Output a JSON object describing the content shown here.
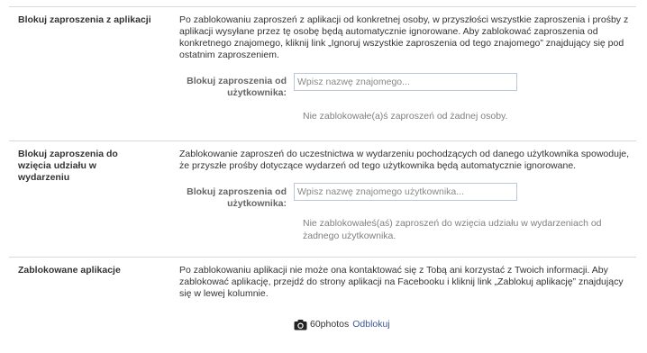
{
  "sections": {
    "apps": {
      "title": "Blokuj zaproszenia z aplikacji",
      "description": "Po zablokowaniu zaproszeń z aplikacji od konkretnej osoby, w przyszłości wszystkie zaproszenia i prośby z aplikacji wysyłane przez tę osobę będą automatycznie ignorowane. Aby zablokować zaproszenia od konkretnego znajomego, kliknij link „Ignoruj wszystkie zaproszenia od tego znajomego” znajdujący się pod ostatnim zaproszeniem.",
      "field_label": "Blokuj zaproszenia od użytkownika:",
      "input_value": "",
      "input_placeholder": "Wpisz nazwę znajomego...",
      "note": "Nie zablokowałe(a)ś zaproszeń od żadnej osoby."
    },
    "events": {
      "title": "Blokuj zaproszenia do wzięcia udziału w wydarzeniu",
      "description": "Zablokowanie zaproszeń do uczestnictwa w wydarzeniu pochodzących od danego użytkownika spowoduje, że przyszłe prośby dotyczące wydarzeń od tego użytkownika będą automatycznie ignorowane.",
      "field_label": "Blokuj zaproszenia od użytkownika:",
      "input_value": "",
      "input_placeholder": "Wpisz nazwę znajomego użytkownika...",
      "note": "Nie zablokowałeś(aś) zaproszeń do wzięcia udziału w wydarzeniach od żadnego użytkownika."
    },
    "blocked_apps": {
      "title": "Zablokowane aplikacje",
      "description": "Po zablokowaniu aplikacji nie może ona kontaktować się z Tobą ani korzystać z Twoich informacji. Aby zablokować aplikację, przejdź do strony aplikacji na Facebooku i kliknij link „Zablokuj aplikację” znajdujący się w lewej kolumnie.",
      "apps": [
        {
          "name": "60photos",
          "icon": "camera-icon",
          "action_label": "Odblokuj"
        }
      ]
    }
  },
  "colors": {
    "link": "#3b5998",
    "divider": "#d9d9d9",
    "input_border": "#bdc7d8",
    "note_text": "#808080"
  }
}
